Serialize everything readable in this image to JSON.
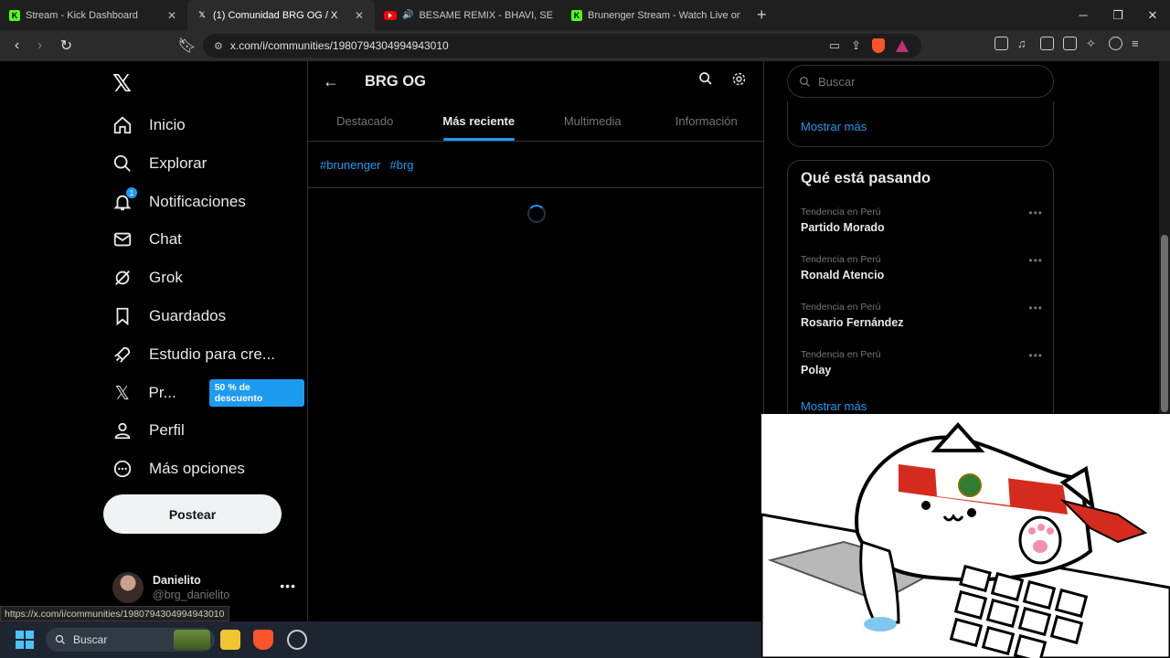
{
  "browser": {
    "tabs": [
      {
        "label": "Stream - Kick Dashboard",
        "favicon": "kick-icon"
      },
      {
        "label": "(1) Comunidad BRG OG / X",
        "favicon": "x-icon"
      },
      {
        "label": "BESAME REMIX - BHAVI, SEVEN K",
        "favicon": "youtube-icon"
      },
      {
        "label": "Brunenger Stream - Watch Live on Ki",
        "favicon": "kick-icon"
      }
    ],
    "url": "x.com/i/communities/1980794304994943010",
    "status_url": "https://x.com/i/communities/1980794304994943010"
  },
  "nav": {
    "items": [
      {
        "label": "Inicio",
        "icon": "home-icon"
      },
      {
        "label": "Explorar",
        "icon": "search-icon"
      },
      {
        "label": "Notificaciones",
        "icon": "bell-icon",
        "badge": "1"
      },
      {
        "label": "Chat",
        "icon": "mail-icon"
      },
      {
        "label": "Grok",
        "icon": "grok-icon"
      },
      {
        "label": "Guardados",
        "icon": "bookmark-icon"
      },
      {
        "label": "Estudio para cre...",
        "icon": "rocket-icon"
      },
      {
        "label": "Pr...",
        "icon": "x-premium-icon",
        "promo": "50 % de descuento"
      },
      {
        "label": "Perfil",
        "icon": "person-icon"
      },
      {
        "label": "Más opciones",
        "icon": "more-circle-icon"
      }
    ],
    "post_button": "Postear",
    "account": {
      "name": "Danielito",
      "handle": "@brg_danielito"
    }
  },
  "community": {
    "title": "BRG OG",
    "tabs": [
      "Destacado",
      "Más reciente",
      "Multimedia",
      "Información"
    ],
    "active_tab": "Más reciente",
    "hashtags": [
      "#brunenger",
      "#brg"
    ]
  },
  "sidebar": {
    "search_placeholder": "Buscar",
    "show_more_top": "Mostrar más",
    "trending_title": "Qué está pasando",
    "trends": [
      {
        "context": "Tendencia en Perú",
        "name": "Partido Morado"
      },
      {
        "context": "Tendencia en Perú",
        "name": "Ronald Atencio"
      },
      {
        "context": "Tendencia en Perú",
        "name": "Rosario Fernández"
      },
      {
        "context": "Tendencia en Perú",
        "name": "Polay"
      }
    ],
    "show_more_bottom": "Mostrar más"
  },
  "taskbar": {
    "search_label": "Buscar"
  },
  "colors": {
    "accent": "#1d9bf0",
    "background": "#000000",
    "border": "#2f3336"
  }
}
